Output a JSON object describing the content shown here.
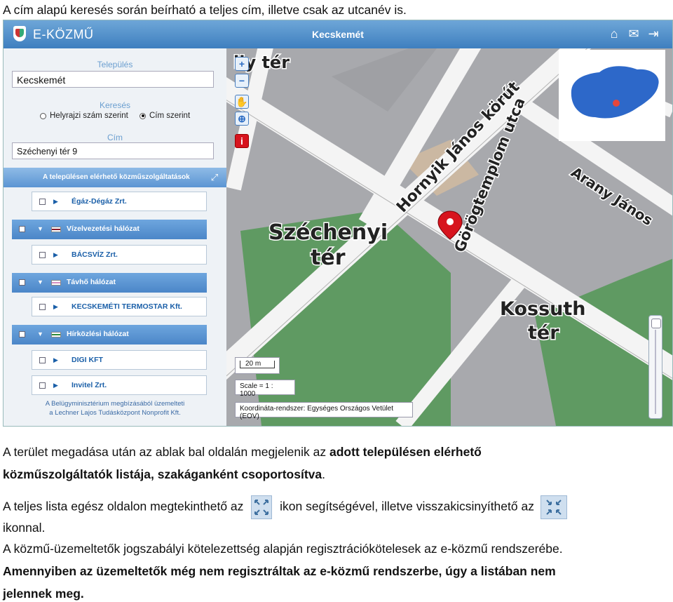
{
  "doc": {
    "intro": "A cím alapú keresés során beírható a teljes cím, illetve csak az utcanév is.",
    "para1_a": "A terület megadása után az ablak bal oldalán megjelenik az ",
    "para1_b": "adott településen elérhető",
    "para1_c": "közműszolgáltatók listája, szakáganként csoportosítva",
    "para1_d": ".",
    "para2_a": "A teljes lista egész oldalon megtekinthető az",
    "para2_b": "ikon segítségével, illetve visszakicsinyíthető az",
    "para2_c": "ikonnal.",
    "para3": "A közmű-üzemeltetők jogszabályi kötelezettség alapján regisztrációkötelesek az e-közmű rendszerébe.",
    "para4_a": "Amennyiben az üzemeltetők még nem regisztráltak az e-közmű rendszerbe, úgy a listában nem",
    "para4_b": "jelennek meg."
  },
  "app": {
    "brand": "E-KÖZMŰ",
    "city_title": "Kecskemét",
    "icons": [
      "home-icon",
      "mail-icon",
      "logout-icon"
    ],
    "settlement_label": "Település",
    "settlement_value": "Kecskemét",
    "search_label": "Keresés",
    "radio_parcel": "Helyrajzi szám szerint",
    "radio_address": "Cím szerint",
    "radio_selected": "address",
    "address_label": "Cím",
    "address_value": "Széchenyi tér 9",
    "list_header": "A településen elérhető közműszolgáltatások",
    "utilities": [
      {
        "kind": "sub",
        "label": "Égáz-Dégáz Zrt."
      },
      {
        "kind": "cat",
        "label": "Vízelvezetési hálózat",
        "flag": "#8a1b2a"
      },
      {
        "kind": "sub",
        "label": "BÁCSVÍZ Zrt."
      },
      {
        "kind": "cat",
        "label": "Távhő hálózat",
        "flag": "#d48fc0"
      },
      {
        "kind": "sub",
        "label": "KECSKEMÉTI TERMOSTAR Kft."
      },
      {
        "kind": "cat",
        "label": "Hírközlési hálózat",
        "flag": "#2e8b3a"
      },
      {
        "kind": "sub",
        "label": "DIGI KFT"
      },
      {
        "kind": "sub",
        "label": "Invitel Zrt."
      }
    ],
    "footer_line1": "A Belügyminisztérium megbízásából üzemelteti",
    "footer_line2": "a Lechner Lajos Tudásközpont Nonprofit Kft.",
    "scale_bar": "20 m",
    "scale_ratio": "Scale = 1 : 1000",
    "coord_system": "Koordináta-rendszer: Egységes Országos Vetület (EOV)",
    "map_labels": {
      "ily_ter": "ily tér",
      "hornyik": "Hornyik János körút",
      "gorogtemplom": "Görögtemplom utca",
      "arany": "Arany János",
      "szechenyi": "Széchenyi",
      "ter1": "tér",
      "kossuth": "Kossuth",
      "ter2": "tér"
    },
    "colors": {
      "accent": "#4b86c8",
      "marker": "#d7141e",
      "park": "#5f9a62"
    }
  }
}
